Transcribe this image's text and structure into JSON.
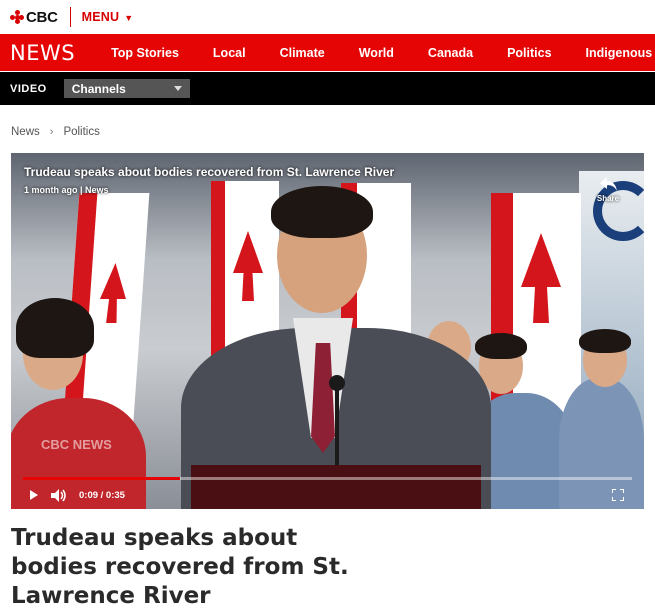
{
  "header": {
    "logo_text": "CBC",
    "menu_label": "MENU"
  },
  "news_nav": {
    "brand": "NEWS",
    "items": [
      {
        "label": "Top Stories"
      },
      {
        "label": "Local"
      },
      {
        "label": "Climate"
      },
      {
        "label": "World"
      },
      {
        "label": "Canada"
      },
      {
        "label": "Politics"
      },
      {
        "label": "Indigenous"
      }
    ]
  },
  "video_bar": {
    "label": "VIDEO",
    "channels_selected": "Channels"
  },
  "breadcrumb": {
    "items": [
      "News",
      "Politics"
    ],
    "separator": "›"
  },
  "player": {
    "title": "Trudeau speaks about bodies recovered from St. Lawrence River",
    "meta": "1 month ago | News",
    "share_label": "Share",
    "time_display": "0:09 / 0:35",
    "progress_fraction": 0.257,
    "watermark": "CBC NEWS",
    "icons": [
      "share-icon",
      "play-icon",
      "volume-icon",
      "fullscreen-icon"
    ]
  },
  "article": {
    "headline": "Trudeau speaks about bodies recovered from St. Lawrence River"
  },
  "colors": {
    "brand_red": "#e60505",
    "video_bar_bg": "#000000",
    "channels_bg": "#555555"
  }
}
